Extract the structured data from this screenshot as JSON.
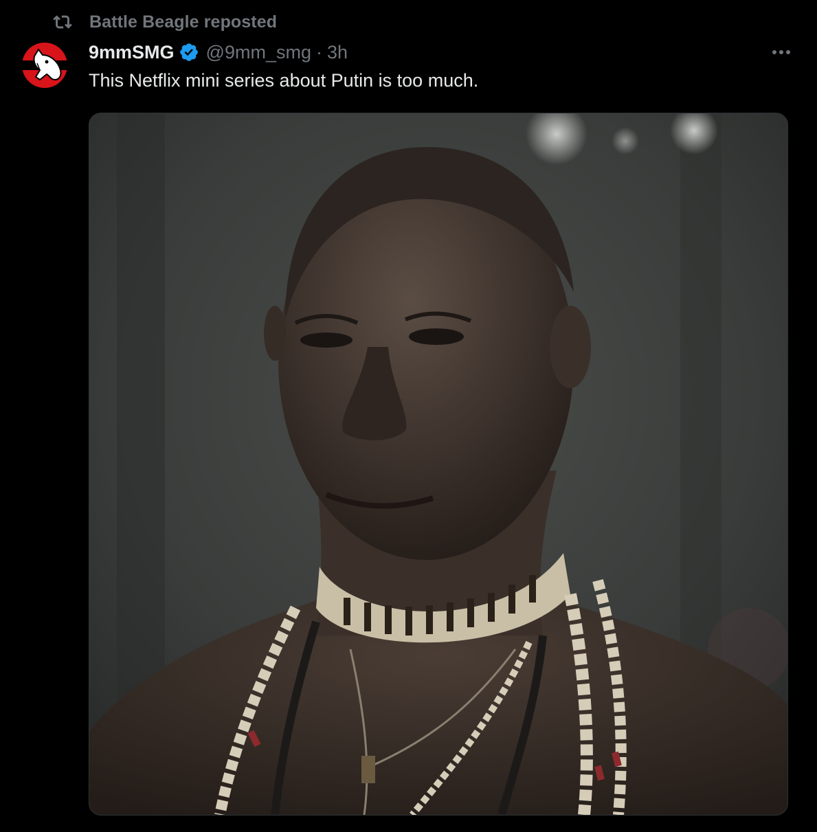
{
  "repost": {
    "label": "Battle Beagle reposted",
    "icon": "repost-icon"
  },
  "author": {
    "display_name": "9mmSMG",
    "verified": true,
    "verified_icon": "verified-badge-icon",
    "handle": "@9mm_smg",
    "separator": "·",
    "time": "3h",
    "avatar_icon": "horse-head-logo-icon"
  },
  "tweet": {
    "text": "This Netflix mini series about Putin is too much."
  },
  "menu": {
    "icon": "more-options-icon"
  },
  "media": {
    "type": "photo"
  },
  "colors": {
    "background": "#000000",
    "primary_text": "#e7e9ea",
    "secondary_text": "#71767b",
    "verified_blue": "#1d9bf0",
    "avatar_red": "#d7141a",
    "border": "#2f3336"
  }
}
